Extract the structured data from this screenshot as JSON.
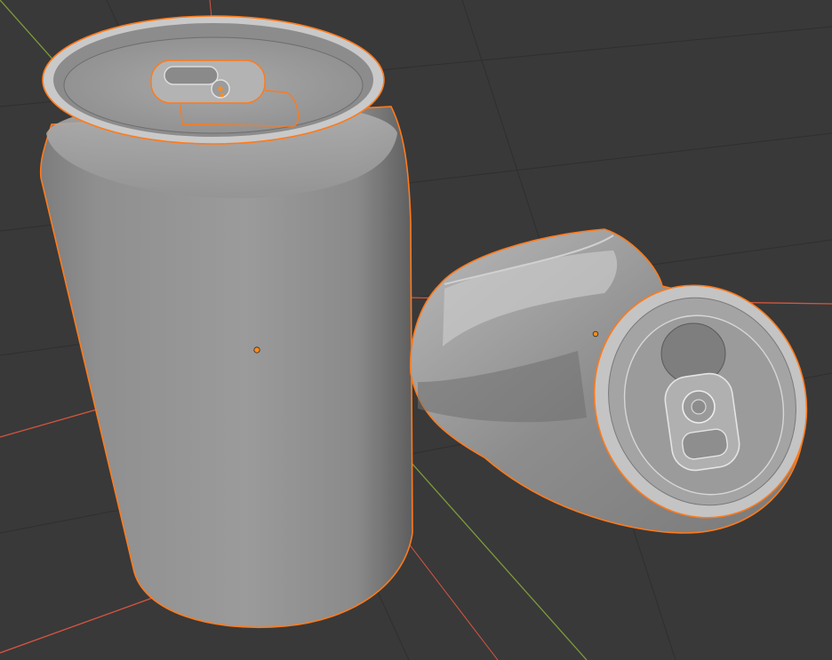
{
  "viewport": {
    "background": "#393939",
    "grid_line_color": "#2f2f2f",
    "x_axis_color": "#d6553f",
    "y_axis_color": "#7c9a3c",
    "selection_outline_color": "#ff7a1a",
    "object_origin_color": "#ff8c1a"
  },
  "objects": [
    {
      "name": "standing-soda-can",
      "state": "selected",
      "material": "solid-gray"
    },
    {
      "name": "crushed-soda-can",
      "state": "selected",
      "material": "solid-gray"
    }
  ]
}
